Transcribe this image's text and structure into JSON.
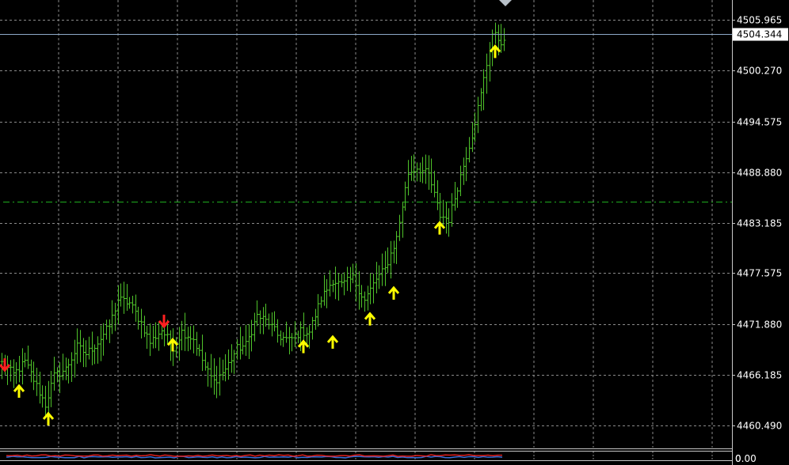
{
  "chart_data": {
    "type": "bar",
    "subtype": "ohlc",
    "background": "#000000",
    "colors": {
      "bar": "#4fc32a",
      "grid": "#8a8a8a",
      "axis_text": "#ffffff",
      "buy_arrow": "#ffff00",
      "sell_arrow": "#ff2020",
      "current_price_line": "#8ea9c8",
      "level_line": "#1fae1f",
      "indicator_red": "#e02020",
      "indicator_blue": "#3a6fd8"
    },
    "y_axis": {
      "ticks": [
        "4505.965",
        "4500.270",
        "4494.575",
        "4488.880",
        "4483.185",
        "4477.575",
        "4471.880",
        "4466.185",
        "4460.490"
      ],
      "ylim": [
        4458.0,
        4508.2
      ]
    },
    "current_price": "4504.344",
    "level_line_price": 4485.6,
    "indicator_panel": {
      "labels": [
        "0.00",
        "0"
      ]
    },
    "close_path": [
      [
        0,
        4467.5
      ],
      [
        4,
        4466.2
      ],
      [
        8,
        4467.6
      ],
      [
        11,
        4465.6
      ],
      [
        15,
        4462.8
      ],
      [
        18,
        4466.0
      ],
      [
        22,
        4466.8
      ],
      [
        26,
        4469.3
      ],
      [
        29,
        4468.5
      ],
      [
        33,
        4469.8
      ],
      [
        37,
        4471.6
      ],
      [
        40,
        4474.6
      ],
      [
        44,
        4474.2
      ],
      [
        48,
        4472.0
      ],
      [
        51,
        4469.8
      ],
      [
        55,
        4471.2
      ],
      [
        59,
        4469.3
      ],
      [
        62,
        4471.0
      ],
      [
        66,
        4470.2
      ],
      [
        70,
        4467.0
      ],
      [
        73,
        4465.4
      ],
      [
        77,
        4466.8
      ],
      [
        81,
        4469.1
      ],
      [
        84,
        4469.5
      ],
      [
        88,
        4472.8
      ],
      [
        92,
        4472.0
      ],
      [
        95,
        4470.6
      ],
      [
        99,
        4470.0
      ],
      [
        103,
        4471.0
      ],
      [
        106,
        4471.0
      ],
      [
        110,
        4474.7
      ],
      [
        114,
        4476.8
      ],
      [
        117,
        4476.2
      ],
      [
        121,
        4477.0
      ],
      [
        125,
        4474.5
      ],
      [
        129,
        4476.9
      ],
      [
        132,
        4478.0
      ],
      [
        136,
        4481.5
      ],
      [
        140,
        4488.8
      ],
      [
        143,
        4489.4
      ],
      [
        147,
        4488.6
      ],
      [
        151,
        4484.0
      ],
      [
        154,
        4483.6
      ],
      [
        158,
        4488.5
      ],
      [
        162,
        4493.1
      ],
      [
        165,
        4497.6
      ],
      [
        169,
        4504.4
      ],
      [
        173,
        4503.3
      ]
    ],
    "buy_signals": [
      {
        "bar": 6,
        "price": 4464.3
      },
      {
        "bar": 16,
        "price": 4461.2
      },
      {
        "bar": 59,
        "price": 4469.5
      },
      {
        "bar": 104,
        "price": 4469.3
      },
      {
        "bar": 114,
        "price": 4469.8
      },
      {
        "bar": 127,
        "price": 4472.4
      },
      {
        "bar": 135,
        "price": 4475.3
      },
      {
        "bar": 151,
        "price": 4482.6
      },
      {
        "bar": 170,
        "price": 4502.4
      }
    ],
    "sell_signals": [
      {
        "bar": 1,
        "price": 4467.3
      },
      {
        "bar": 56,
        "price": 4472.2
      }
    ],
    "grid": true
  }
}
